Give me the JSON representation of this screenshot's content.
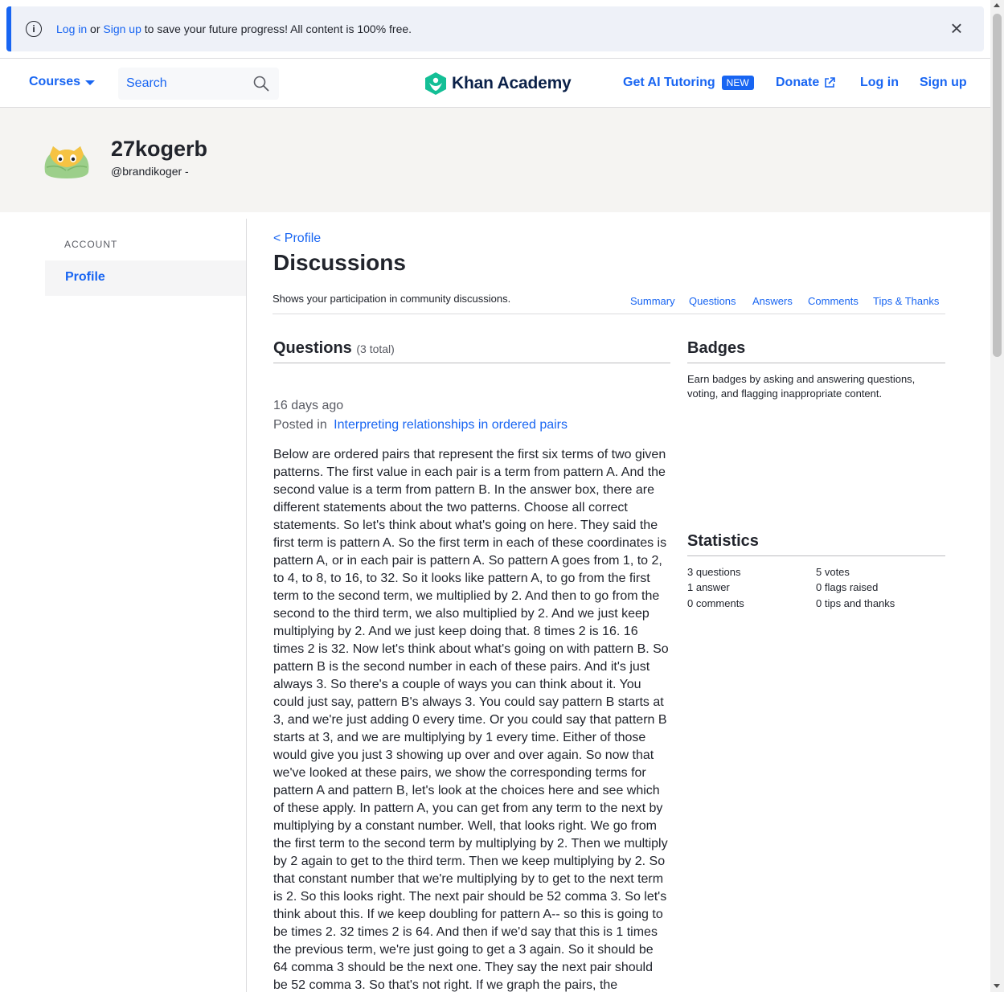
{
  "banner": {
    "login": "Log in",
    "or": " or ",
    "signup": "Sign up",
    "message": " to save your future progress! All content is 100% free.",
    "close_icon": "close-icon"
  },
  "nav": {
    "courses": "Courses",
    "search_placeholder": "Search",
    "logo": "Khan Academy",
    "ai": "Get AI Tutoring",
    "new_badge": "NEW",
    "donate": "Donate",
    "login": "Log in",
    "signup": "Sign up"
  },
  "profile": {
    "name": "27kogerb",
    "handle": "@brandikoger -"
  },
  "sidebar": {
    "section": "ACCOUNT",
    "items": [
      {
        "label": "Profile"
      }
    ]
  },
  "main": {
    "back": "< Profile",
    "title": "Discussions",
    "description": "Shows your participation in community discussions.",
    "tabs": [
      "Summary",
      "Questions",
      "Answers",
      "Comments",
      "Tips & Thanks"
    ]
  },
  "questions": {
    "heading": "Questions",
    "total": "(3 total)",
    "item": {
      "time": "16 days ago",
      "posted_in_label": "Posted in",
      "topic": "Interpreting relationships in ordered pairs",
      "body": "Below are ordered pairs that represent the first six terms of two given patterns. The first value in each pair is a term from pattern A. And the second value is a term from pattern B. In the answer box, there are different statements about the two patterns. Choose all correct statements. So let's think about what's going on here. They said the first term is pattern A. So the first term in each of these coordinates is pattern A, or in each pair is pattern A. So pattern A goes from 1, to 2, to 4, to 8, to 16, to 32. So it looks like pattern A, to go from the first term to the second term, we multiplied by 2. And then to go from the second to the third term, we also multiplied by 2. And we just keep multiplying by 2. And we just keep doing that. 8 times 2 is 16. 16 times 2 is 32. Now let's think about what's going on with pattern B. So pattern B is the second number in each of these pairs. And it's just always 3. So there's a couple of ways you can think about it. You could just say, pattern B's always 3. You could say pattern B starts at 3, and we're just adding 0 every time. Or you could say that pattern B starts at 3, and we are multiplying by 1 every time. Either of those would give you just 3 showing up over and over again. So now that we've looked at these pairs, we show the corresponding terms for pattern A and pattern B, let's look at the choices here and see which of these apply. In pattern A, you can get from any term to the next by multiplying by a constant number. Well, that looks right. We go from the first term to the second term by multiplying by 2. Then we multiply by 2 again to get to the third term. Then we keep multiplying by 2. So that constant number that we're multiplying by to get to the next term is 2. So this looks right. The next pair should be 52 comma 3. So let's think about this. If we keep doubling for pattern A-- so this is going to be times 2. 32 times 2 is 64. And then if we'd say that this is 1 times the previous term, we're just going to get a 3 again. So it should be 64 comma 3 should be the next one. They say the next pair should be 52 comma 3. So that's not right. If we graph the pairs, the"
    }
  },
  "badges": {
    "heading": "Badges",
    "description": "Earn badges by asking and answering questions, voting, and flagging inappropriate content."
  },
  "statistics": {
    "heading": "Statistics",
    "left": [
      "3 questions",
      "1 answer",
      "0 comments"
    ],
    "right": [
      "5 votes",
      "0 flags raised",
      "0 tips and thanks"
    ]
  },
  "colors": {
    "link": "#1865f2",
    "banner_bg": "#eef1f8",
    "header_bg": "#f5f4f2",
    "logo_green": "#14bf96"
  }
}
